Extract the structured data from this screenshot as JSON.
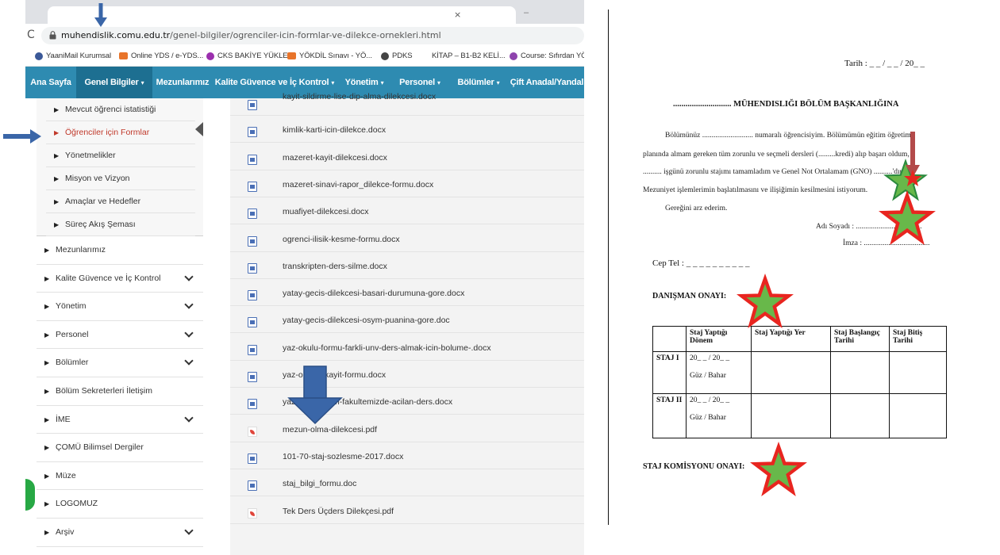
{
  "browser": {
    "url_host": "muhendislik.comu.edu.tr",
    "url_path": "/genel-bilgiler/ogrenciler-icin-formlar-ve-dilekce-ornekleri.html",
    "bookmarks": [
      {
        "label": "YaaniMail Kurumsal",
        "icon": "mail-icon",
        "color": "#3b5998"
      },
      {
        "label": "Online YDS / e-YDS...",
        "icon": "folder-icon",
        "color": "#e8742a"
      },
      {
        "label": "CKS BAKİYE YÜKLE...",
        "icon": "circle-logo-icon",
        "color": "#9b2fae"
      },
      {
        "label": "YÖKDİL Sınavı - YÖ...",
        "icon": "folder-icon",
        "color": "#e8742a"
      },
      {
        "label": "PDKS",
        "icon": "globe-icon",
        "color": "#444444"
      },
      {
        "label": "KİTAP – B1-B2 KELİ...",
        "icon": "",
        "color": ""
      },
      {
        "label": "Course: Sıfırdan YÖ...",
        "icon": "circle-logo-icon",
        "color": "#8e44ad"
      }
    ]
  },
  "navbar": {
    "items": [
      {
        "label": "Ana Sayfa",
        "caret": false
      },
      {
        "label": "Genel Bilgiler",
        "caret": true
      },
      {
        "label": "Mezunlarımız",
        "caret": false
      },
      {
        "label": "Kalite Güvence ve İç Kontrol",
        "caret": true
      },
      {
        "label": "Yönetim",
        "caret": true
      },
      {
        "label": "Personel",
        "caret": true
      },
      {
        "label": "Bölümler",
        "caret": true
      },
      {
        "label": "Çift Anadal/Yandal",
        "caret": false
      }
    ],
    "caret_glyph": "▾"
  },
  "sidebar": {
    "sub_items": [
      {
        "label": "Mevcut öğrenci istatistiği"
      },
      {
        "label": "Öğrenciler için Formlar"
      },
      {
        "label": "Yönetmelikler"
      },
      {
        "label": "Misyon ve Vizyon"
      },
      {
        "label": "Amaçlar ve Hedefler"
      },
      {
        "label": "Süreç Akış Şeması"
      }
    ],
    "items": [
      {
        "label": "Mezunlarımız",
        "chevron": false
      },
      {
        "label": "Kalite Güvence ve İç Kontrol",
        "chevron": true
      },
      {
        "label": "Yönetim",
        "chevron": true
      },
      {
        "label": "Personel",
        "chevron": true
      },
      {
        "label": "Bölümler",
        "chevron": true
      },
      {
        "label": "Bölüm Sekreterleri İletişim",
        "chevron": false
      },
      {
        "label": "İME",
        "chevron": true
      },
      {
        "label": "ÇOMÜ Bilimsel Dergiler",
        "chevron": false
      },
      {
        "label": "Müze",
        "chevron": false
      },
      {
        "label": "LOGOMUZ",
        "chevron": false
      },
      {
        "label": "Arşiv",
        "chevron": true
      }
    ],
    "triangle_glyph": "▶"
  },
  "files": [
    {
      "name": "kayit-sildirme-lise-dip-alma-dilekcesi.docx",
      "type": "word"
    },
    {
      "name": "kimlik-karti-icin-dilekce.docx",
      "type": "word"
    },
    {
      "name": "mazeret-kayit-dilekcesi.docx",
      "type": "word"
    },
    {
      "name": "mazeret-sinavi-rapor_dilekce-formu.docx",
      "type": "word"
    },
    {
      "name": "muafiyet-dilekcesi.docx",
      "type": "word"
    },
    {
      "name": "ogrenci-ilisik-kesme-formu.docx",
      "type": "word"
    },
    {
      "name": "transkripten-ders-silme.docx",
      "type": "word"
    },
    {
      "name": "yatay-gecis-dilekcesi-basari-durumuna-gore.docx",
      "type": "word"
    },
    {
      "name": "yatay-gecis-dilekcesi-osym-puanina-gore.doc",
      "type": "word"
    },
    {
      "name": "yaz-okulu-formu-farkli-unv-ders-almak-icin-bolume-.docx",
      "type": "word"
    },
    {
      "name": "yaz-o          ecici-kayit-formu.docx",
      "type": "word"
    },
    {
      "name": "yaz-          it-icin-form-fakultemizde-acilan-ders.docx",
      "type": "word"
    },
    {
      "name": "mezun-olma-dilekcesi.pdf",
      "type": "pdf"
    },
    {
      "name": "101-70-staj-sozlesme-2017.docx",
      "type": "word"
    },
    {
      "name": "staj_bilgi_formu.doc",
      "type": "word"
    },
    {
      "name": "Tek Ders Üçders Dilekçesi.pdf",
      "type": "pdf"
    }
  ],
  "document": {
    "date": "Tarih  : _ _ / _ _ / 20_ _",
    "heading": "............................  MÜHENDISLIĞI BÖLÜM BAŞKANLIĞINA",
    "body": [
      "Bölümünüz ...........................  numaralı öğrencisiyim. Bölümümün eğitim öğretim",
      "planında almam gereken tüm zorunlu ve seçmeli dersleri (.........kredi) alıp başarı oldum,",
      ".......... işgünü zorunlu stajımı tamamladım ve Genel Not Ortalamam (GNO)  ..........'dır.",
      "Mezuniyet işlemlerimin başlatılmasını ve ilişiğimin kesilmesini istiyorum.",
      "Gereğini arz ederim."
    ],
    "adi_soyadi": "Adı Soyadı    : ...................................",
    "imza": "İmza   : ...................................",
    "cep_tel": "Cep Tel : _  _  _   _ _ _   _ _   _ _",
    "danisman": "DANIŞMAN ONAYI:",
    "komisyon": "STAJ KOMİSYONU ONAYI:",
    "table": {
      "headers": [
        "",
        "Staj Yaptığı Dönem",
        "Staj Yaptığı Yer",
        "Staj Başlangıç Tarihi",
        "Staj Bitiş Tarihi"
      ],
      "rows": [
        {
          "label": "STAJ I",
          "period": "20_ _ / 20_ _",
          "season": "Güz / Bahar"
        },
        {
          "label": "STAJ II",
          "period": "20_ _ / 20_ _",
          "season": "Güz / Bahar"
        }
      ]
    }
  },
  "colors": {
    "navbar": "#2e8bb1",
    "navbar_active": "#1d6f91",
    "arrow_blue": "#3a66a8",
    "arrow_red": "#b34a4a",
    "star_red": "#e8251f",
    "star_green": "#68b84a"
  }
}
